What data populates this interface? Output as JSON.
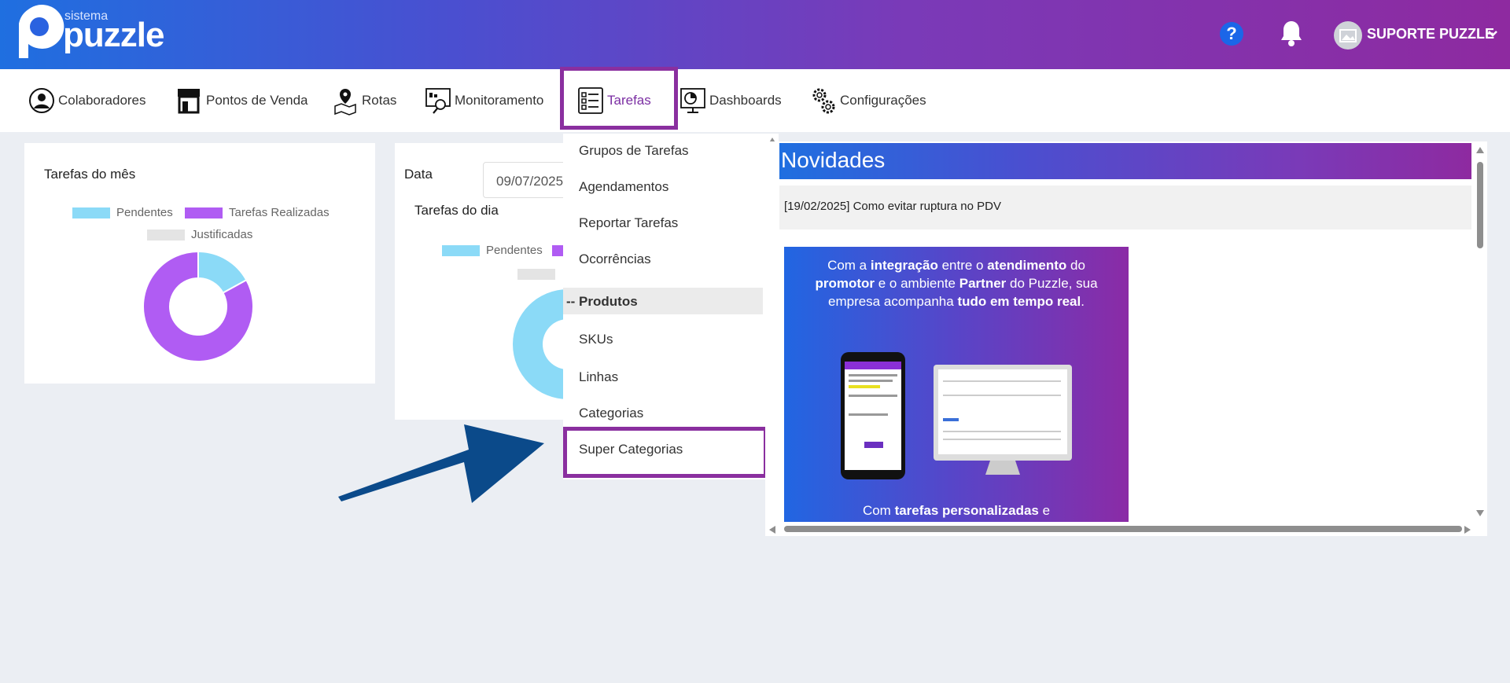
{
  "header": {
    "logo_small": "sistema",
    "logo_big": "puzzle",
    "help_symbol": "?",
    "user_name": "SUPORTE PUZZLE"
  },
  "nav": {
    "items": [
      {
        "label": "Colaboradores",
        "icon": "user-circle-icon"
      },
      {
        "label": "Pontos de Venda",
        "icon": "store-icon"
      },
      {
        "label": "Rotas",
        "icon": "map-pin-icon"
      },
      {
        "label": "Monitoramento",
        "icon": "monitor-search-icon"
      },
      {
        "label": "Tarefas",
        "icon": "checklist-icon",
        "active": true
      },
      {
        "label": "Dashboards",
        "icon": "dashboard-icon"
      },
      {
        "label": "Configurações",
        "icon": "gears-icon"
      }
    ]
  },
  "month_card": {
    "title": "Tarefas do mês",
    "legend": [
      "Pendentes",
      "Tarefas Realizadas",
      "Justificadas"
    ],
    "values": {
      "pendentes": 17,
      "realizadas": 83,
      "justificadas": 0
    }
  },
  "day_card": {
    "date_label": "Data",
    "date_value": "09/07/2025",
    "title": "Tarefas do dia",
    "legend": [
      "Pendentes"
    ]
  },
  "dropdown": {
    "items": [
      "Grupos de Tarefas",
      "Agendamentos",
      "Reportar Tarefas",
      "Ocorrências"
    ],
    "section": "-- Produtos",
    "product_items": [
      "SKUs",
      "Linhas",
      "Categorias",
      "Super Categorias"
    ]
  },
  "news": {
    "title": "Novidades",
    "item": "[19/02/2025] Como evitar ruptura no PDV",
    "image_text_top": [
      "Com a ",
      "integração",
      " entre o ",
      "atendimento",
      " do ",
      "promotor",
      " e o ambiente ",
      "Partner",
      " do Puzzle, sua empresa acompanha ",
      "tudo em tempo real",
      "."
    ],
    "image_text_bottom": [
      "Com ",
      "tarefas personalizadas",
      " e"
    ]
  },
  "colors": {
    "accent": "#8a2f9f",
    "pendentes": "#8bdaf7",
    "realizadas": "#b05cf3",
    "justificadas": "#e4e4e4",
    "arrow": "#0b4a8a"
  }
}
